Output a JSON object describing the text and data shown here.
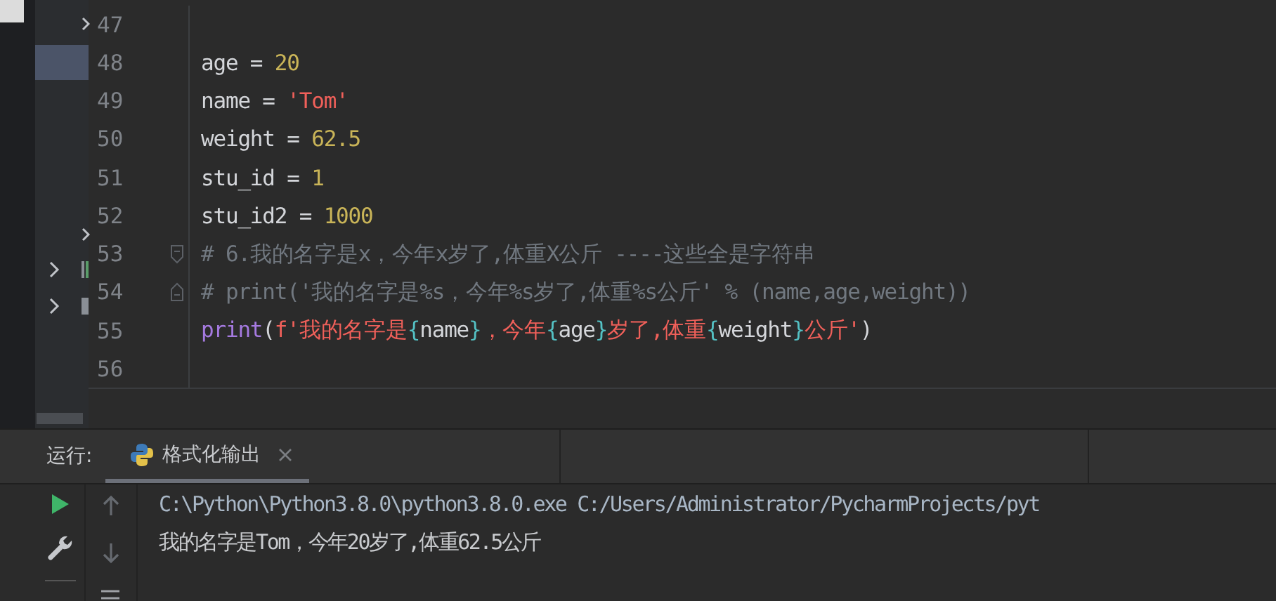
{
  "editor": {
    "lines": [
      {
        "number": "47"
      },
      {
        "number": "48",
        "tokens": [
          {
            "kind": "plain",
            "text": "age = "
          },
          {
            "kind": "number",
            "text": "20"
          }
        ]
      },
      {
        "number": "49",
        "tokens": [
          {
            "kind": "plain",
            "text": "name = "
          },
          {
            "kind": "string",
            "text": "'Tom'"
          }
        ]
      },
      {
        "number": "50",
        "tokens": [
          {
            "kind": "plain",
            "text": "weight = "
          },
          {
            "kind": "number",
            "text": "62.5"
          }
        ]
      },
      {
        "number": "51",
        "tokens": [
          {
            "kind": "plain",
            "text": "stu_id = "
          },
          {
            "kind": "number",
            "text": "1"
          }
        ]
      },
      {
        "number": "52",
        "tokens": [
          {
            "kind": "plain",
            "text": "stu_id2 = "
          },
          {
            "kind": "number",
            "text": "1000"
          }
        ]
      },
      {
        "number": "53",
        "fold_start": true,
        "tokens": [
          {
            "kind": "comment",
            "text": "# 6.我的名字是x，今年x岁了,体重X公斤 ----这些全是字符串"
          }
        ]
      },
      {
        "number": "54",
        "fold_end": true,
        "tokens": [
          {
            "kind": "comment",
            "text": "# print('我的名字是%s，今年%s岁了,体重%s公斤' % (name,age,weight))"
          }
        ]
      },
      {
        "number": "55",
        "tokens": [
          {
            "kind": "keyword",
            "text": "print"
          },
          {
            "kind": "plain",
            "text": "("
          },
          {
            "kind": "string",
            "text": "f'我的名字是"
          },
          {
            "kind": "brace",
            "text": "{"
          },
          {
            "kind": "plain",
            "text": "name"
          },
          {
            "kind": "brace",
            "text": "}"
          },
          {
            "kind": "string",
            "text": "，今年"
          },
          {
            "kind": "brace",
            "text": "{"
          },
          {
            "kind": "plain",
            "text": "age"
          },
          {
            "kind": "brace",
            "text": "}"
          },
          {
            "kind": "string",
            "text": "岁了,体重"
          },
          {
            "kind": "brace",
            "text": "{"
          },
          {
            "kind": "plain",
            "text": "weight"
          },
          {
            "kind": "brace",
            "text": "}"
          },
          {
            "kind": "string",
            "text": "公斤'"
          },
          {
            "kind": "plain",
            "text": ")"
          }
        ]
      },
      {
        "number": "56"
      }
    ]
  },
  "run_panel": {
    "label": "运行:",
    "tabs": [
      {
        "label": "格式化输出",
        "selected": true
      }
    ],
    "output": [
      "C:\\Python\\Python3.8.0\\python3.8.0.exe C:/Users/Administrator/PycharmProjects/pyt",
      "我的名字是Tom，今年20岁了,体重62.5公斤"
    ]
  }
}
